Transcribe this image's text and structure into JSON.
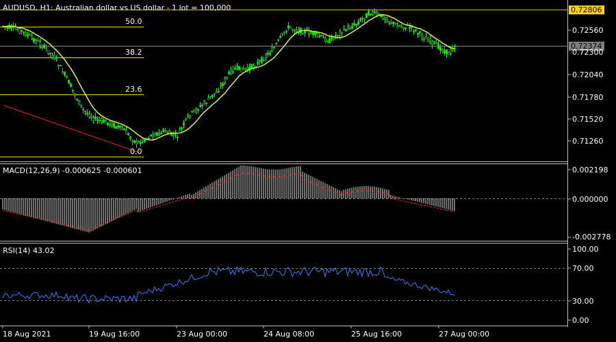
{
  "header": {
    "symbol": "AUDUSD",
    "timeframe": "H1",
    "description": "Australian dollar vs US dollar - 1 lot = 100,000"
  },
  "price_tags": {
    "top_line": "0.72806",
    "current": "0.72374"
  },
  "main_axis": [
    "0.72560",
    "0.72300",
    "0.72040",
    "0.71780",
    "0.71520",
    "0.71260"
  ],
  "fib_levels": [
    "50.0",
    "38.2",
    "23.6",
    "0.0"
  ],
  "macd": {
    "label": "MACD(12,26,9) -0.000625 -0.000601",
    "axis": [
      "0.002198",
      "0.000000",
      "-0.002778"
    ]
  },
  "rsi": {
    "label": "RSI(14) 43.02",
    "axis": [
      "100.00",
      "70.00",
      "30.00",
      "0.00"
    ]
  },
  "time_axis": [
    "18 Aug 2021",
    "19 Aug 16:00",
    "23 Aug 00:00",
    "24 Aug 08:00",
    "25 Aug 16:00",
    "27 Aug 00:00"
  ],
  "colors": {
    "candle": "#00ff00",
    "ma": "#ccff33",
    "fib": "#e6e600",
    "trend": "#ff2020",
    "macd_signal": "#ff2020",
    "rsi": "#3b7cff",
    "grid": "#7f7f7f",
    "tag_top_bg": "#ffd21a",
    "tag_cur_bg": "#808080"
  },
  "chart_data": {
    "type": "line",
    "x": [
      "18 Aug 2021",
      "19 Aug 16:00",
      "23 Aug 00:00",
      "24 Aug 08:00",
      "25 Aug 16:00",
      "27 Aug 00:00"
    ],
    "series": [
      {
        "values": [
          0.7262,
          0.716,
          0.7135,
          0.7235,
          0.727,
          0.7236
        ]
      }
    ],
    "ylim": [
      0.7105,
      0.7285
    ]
  }
}
